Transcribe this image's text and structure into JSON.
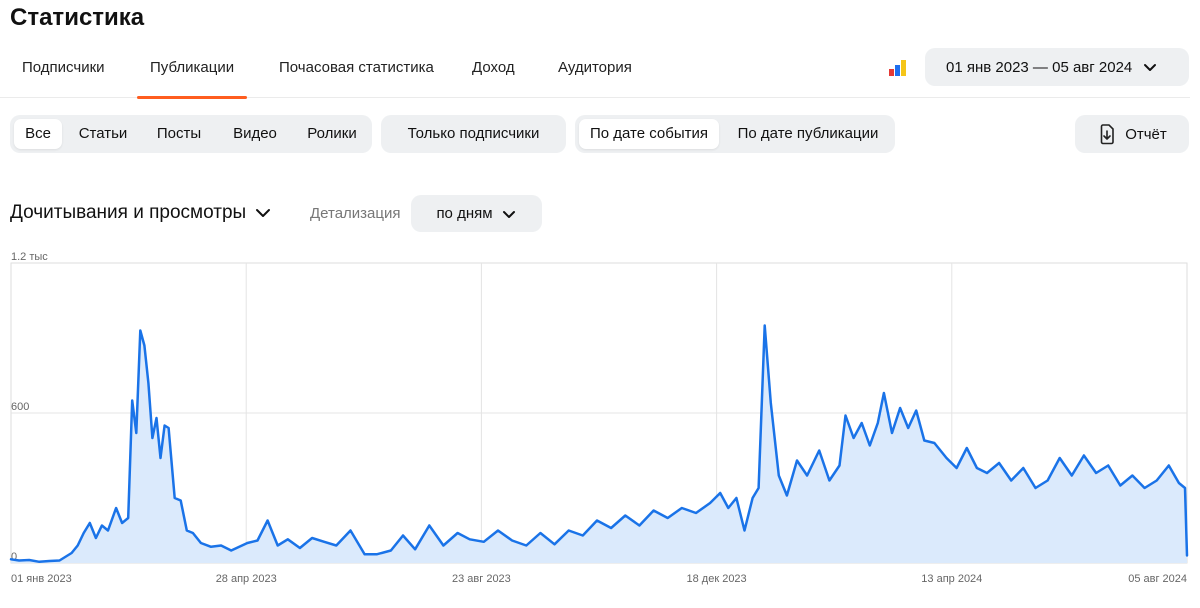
{
  "page": {
    "title": "Статистика"
  },
  "tabs": [
    {
      "label": "Подписчики"
    },
    {
      "label": "Публикации",
      "active": true
    },
    {
      "label": "Почасовая статистика"
    },
    {
      "label": "Доход"
    },
    {
      "label": "Аудитория"
    }
  ],
  "brand_icon": {
    "name": "bar-chart-brand-icon",
    "colors": [
      "#e53935",
      "#1e6ff0",
      "#f5c518"
    ]
  },
  "date_range": {
    "label": "01 янв 2023 — 05 авг 2024"
  },
  "content_filter": {
    "items": [
      {
        "label": "Все",
        "active": true
      },
      {
        "label": "Статьи"
      },
      {
        "label": "Посты"
      },
      {
        "label": "Видео"
      },
      {
        "label": "Ролики"
      }
    ]
  },
  "subscribers_filter": {
    "label": "Только подписчики"
  },
  "date_mode": {
    "items": [
      {
        "label": "По дате события",
        "active": true
      },
      {
        "label": "По дате публикации"
      }
    ]
  },
  "report_button": {
    "label": "Отчёт"
  },
  "metric": {
    "label": "Дочитывания и просмотры"
  },
  "detail": {
    "label": "Детализация",
    "value": "по дням"
  },
  "colors": {
    "accent": "#ff5d1f",
    "line": "#1a73e8",
    "area": "#dbeafc",
    "button_bg": "#eef0f2"
  },
  "chart_data": {
    "type": "area",
    "title": "",
    "xlabel": "",
    "ylabel": "",
    "x_ticks": [
      "01 янв 2023",
      "28 апр 2023",
      "23 авг 2023",
      "18 дек 2023",
      "13 апр 2024",
      "05 авг 2024"
    ],
    "y_ticks": [
      {
        "value": 0,
        "label": "0"
      },
      {
        "value": 600,
        "label": "600"
      },
      {
        "value": 1200,
        "label": "1.2 тыс"
      }
    ],
    "ylim": [
      0,
      1200
    ],
    "x_range": [
      "2023-01-01",
      "2024-08-05"
    ],
    "grid": true,
    "series": [
      {
        "values": [
          [
            "2023-01-01",
            15
          ],
          [
            "2023-01-05",
            10
          ],
          [
            "2023-01-10",
            12
          ],
          [
            "2023-01-15",
            5
          ],
          [
            "2023-01-20",
            8
          ],
          [
            "2023-01-25",
            10
          ],
          [
            "2023-01-31",
            40
          ],
          [
            "2023-02-03",
            70
          ],
          [
            "2023-02-06",
            120
          ],
          [
            "2023-02-09",
            160
          ],
          [
            "2023-02-12",
            100
          ],
          [
            "2023-02-15",
            150
          ],
          [
            "2023-02-18",
            130
          ],
          [
            "2023-02-22",
            220
          ],
          [
            "2023-02-25",
            160
          ],
          [
            "2023-02-28",
            180
          ],
          [
            "2023-03-02",
            650
          ],
          [
            "2023-03-04",
            520
          ],
          [
            "2023-03-06",
            930
          ],
          [
            "2023-03-08",
            870
          ],
          [
            "2023-03-10",
            720
          ],
          [
            "2023-03-12",
            500
          ],
          [
            "2023-03-14",
            580
          ],
          [
            "2023-03-16",
            420
          ],
          [
            "2023-03-18",
            550
          ],
          [
            "2023-03-20",
            540
          ],
          [
            "2023-03-23",
            260
          ],
          [
            "2023-03-26",
            250
          ],
          [
            "2023-03-29",
            130
          ],
          [
            "2023-04-01",
            120
          ],
          [
            "2023-04-05",
            80
          ],
          [
            "2023-04-10",
            65
          ],
          [
            "2023-04-15",
            70
          ],
          [
            "2023-04-20",
            50
          ],
          [
            "2023-04-28",
            80
          ],
          [
            "2023-05-03",
            90
          ],
          [
            "2023-05-08",
            170
          ],
          [
            "2023-05-13",
            70
          ],
          [
            "2023-05-18",
            95
          ],
          [
            "2023-05-24",
            60
          ],
          [
            "2023-05-30",
            100
          ],
          [
            "2023-06-05",
            85
          ],
          [
            "2023-06-11",
            70
          ],
          [
            "2023-06-18",
            130
          ],
          [
            "2023-06-25",
            35
          ],
          [
            "2023-07-01",
            35
          ],
          [
            "2023-07-08",
            50
          ],
          [
            "2023-07-14",
            110
          ],
          [
            "2023-07-20",
            55
          ],
          [
            "2023-07-27",
            150
          ],
          [
            "2023-08-03",
            70
          ],
          [
            "2023-08-10",
            120
          ],
          [
            "2023-08-16",
            95
          ],
          [
            "2023-08-23",
            85
          ],
          [
            "2023-08-30",
            130
          ],
          [
            "2023-09-06",
            90
          ],
          [
            "2023-09-13",
            70
          ],
          [
            "2023-09-20",
            120
          ],
          [
            "2023-09-27",
            75
          ],
          [
            "2023-10-04",
            130
          ],
          [
            "2023-10-11",
            110
          ],
          [
            "2023-10-18",
            170
          ],
          [
            "2023-10-25",
            140
          ],
          [
            "2023-11-01",
            190
          ],
          [
            "2023-11-08",
            150
          ],
          [
            "2023-11-15",
            210
          ],
          [
            "2023-11-22",
            180
          ],
          [
            "2023-11-29",
            220
          ],
          [
            "2023-12-06",
            200
          ],
          [
            "2023-12-13",
            240
          ],
          [
            "2023-12-18",
            280
          ],
          [
            "2023-12-22",
            220
          ],
          [
            "2023-12-26",
            260
          ],
          [
            "2023-12-30",
            130
          ],
          [
            "2024-01-03",
            260
          ],
          [
            "2024-01-06",
            300
          ],
          [
            "2024-01-09",
            950
          ],
          [
            "2024-01-12",
            640
          ],
          [
            "2024-01-16",
            350
          ],
          [
            "2024-01-20",
            270
          ],
          [
            "2024-01-25",
            410
          ],
          [
            "2024-01-30",
            350
          ],
          [
            "2024-02-05",
            450
          ],
          [
            "2024-02-10",
            330
          ],
          [
            "2024-02-15",
            390
          ],
          [
            "2024-02-18",
            590
          ],
          [
            "2024-02-22",
            500
          ],
          [
            "2024-02-26",
            560
          ],
          [
            "2024-03-01",
            470
          ],
          [
            "2024-03-05",
            560
          ],
          [
            "2024-03-08",
            680
          ],
          [
            "2024-03-12",
            520
          ],
          [
            "2024-03-16",
            620
          ],
          [
            "2024-03-20",
            540
          ],
          [
            "2024-03-24",
            610
          ],
          [
            "2024-03-28",
            490
          ],
          [
            "2024-04-02",
            480
          ],
          [
            "2024-04-08",
            420
          ],
          [
            "2024-04-13",
            380
          ],
          [
            "2024-04-18",
            460
          ],
          [
            "2024-04-23",
            380
          ],
          [
            "2024-04-28",
            360
          ],
          [
            "2024-05-04",
            400
          ],
          [
            "2024-05-10",
            330
          ],
          [
            "2024-05-16",
            380
          ],
          [
            "2024-05-22",
            300
          ],
          [
            "2024-05-28",
            330
          ],
          [
            "2024-06-03",
            420
          ],
          [
            "2024-06-09",
            350
          ],
          [
            "2024-06-15",
            430
          ],
          [
            "2024-06-21",
            360
          ],
          [
            "2024-06-27",
            390
          ],
          [
            "2024-07-03",
            310
          ],
          [
            "2024-07-09",
            350
          ],
          [
            "2024-07-15",
            300
          ],
          [
            "2024-07-21",
            330
          ],
          [
            "2024-07-27",
            390
          ],
          [
            "2024-08-01",
            320
          ],
          [
            "2024-08-04",
            300
          ],
          [
            "2024-08-05",
            30
          ]
        ]
      }
    ]
  }
}
